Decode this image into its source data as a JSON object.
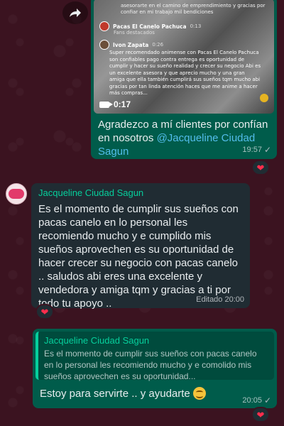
{
  "messages": {
    "forwarded_video": {
      "video": {
        "top_text": "asesorarte en el camino de emprendimiento y gracias por confiar en mi trabajo mil bendiciones",
        "page_name": "Pacas El Canelo Pachuca",
        "page_time": "0:13",
        "page_sub": "Fans destacados",
        "commenter_name": "Ivon Zapata",
        "commenter_time": "0:26",
        "comment": "Super recomendado animense con Pacas El Canelo Pachuca son confiables pago contra entrega es oportunidad de cumplir y hacer su sueño realidad y crecer su negocio Abi es un excelente asesora y que aprecio mucho y una gran amiga que ella también cumplirá sus sueños tqm mucho abi gracias por tan linda atención haces que me anime a hacer más compras...",
        "duration": "0:17"
      },
      "caption_text": "Agradezco a mí clientes por confían en nosotros ",
      "caption_mention": "@Jacqueline Ciudad Sagun",
      "time": "19:57",
      "reaction": "❤"
    },
    "incoming": {
      "sender": "Jacqueline Ciudad Sagun",
      "body": "Es el momento de cumplir sus sueños con pacas canelo en lo personal les recomiendo mucho y e cumplido mis sueños aprovechen es su oportunidad de hacer crecer su negocio con pacas canelo .. saludos abi eres una excelente y vendedora y amiga tqm y gracias a ti por todo tu apoyo ..",
      "meta": "Editado 20:00",
      "reaction": "❤"
    },
    "reply": {
      "quote_sender": "Jacqueline Ciudad Sagun",
      "quote_body": "Es el momento de cumplir sus sueños con pacas canelo en lo personal les recomiendo mucho y e comolido mis sueños aprovechen es su oportunidad...",
      "text": "Estoy para servirte .. y ayudarte",
      "time": "20:05",
      "reaction": "❤"
    }
  },
  "icons": {
    "forward": "forward-icon",
    "check": "✓",
    "video": "video-camera-icon"
  }
}
